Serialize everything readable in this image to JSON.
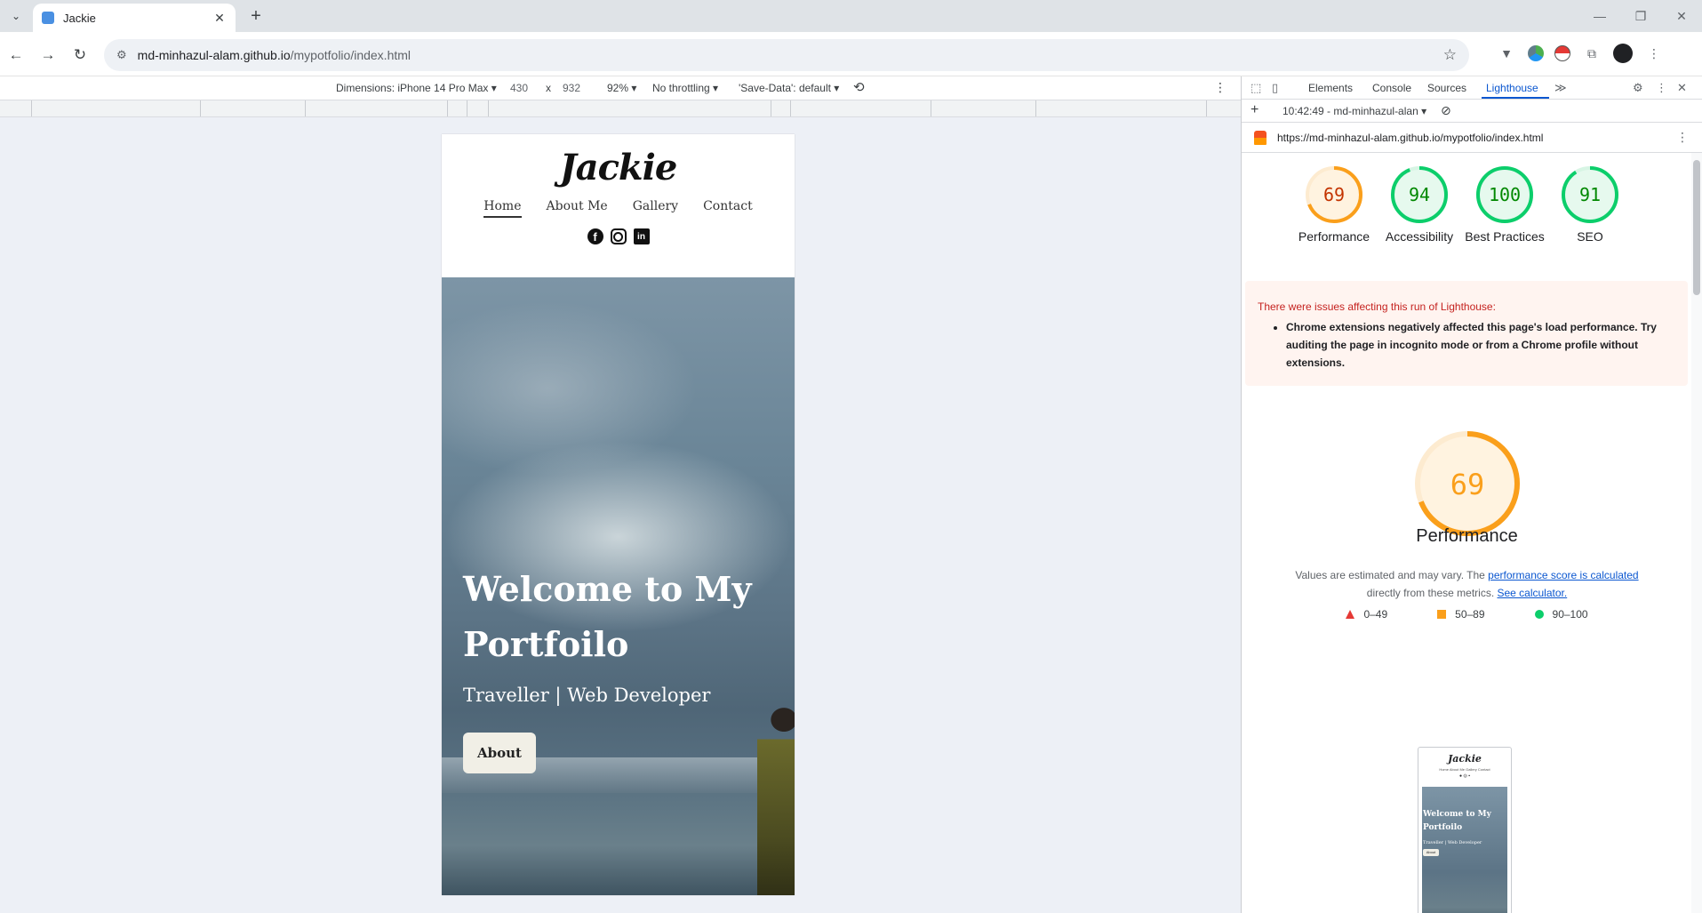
{
  "browser": {
    "tab_title": "Jackie",
    "tab_close": "✕",
    "new_tab": "+",
    "tab_search": "⌄",
    "window_minimize": "—",
    "window_restore": "❐",
    "window_close": "✕",
    "url_host": "md-minhazul-alam.github.io",
    "url_path": "/mypotfolio/index.html",
    "back": "←",
    "forward": "→",
    "reload": "↻",
    "bookmark": "☆"
  },
  "device_toolbar": {
    "dimensions_label": "Dimensions: iPhone 14 Pro Max ▾",
    "width": "430",
    "times": "x",
    "height": "932",
    "zoom": "92% ▾",
    "throttling": "No throttling ▾",
    "save_data": "'Save-Data': default ▾",
    "more": "⋮"
  },
  "site": {
    "brand": "Jackie",
    "nav": [
      "Home",
      "About Me",
      "Gallery",
      "Contact"
    ],
    "active_nav_index": 0,
    "hero_title": "Welcome to My Portfoilo",
    "hero_subtitle": "Traveller | Web Developer",
    "hero_button": "About",
    "social_icons": [
      "facebook-icon",
      "instagram-icon",
      "linkedin-icon"
    ]
  },
  "devtools": {
    "tabs": [
      "Elements",
      "Console",
      "Sources",
      "Lighthouse"
    ],
    "active_tab": "Lighthouse",
    "more_tabs": "≫",
    "report_time": "10:42:49 - md-minhazul-alan ▾",
    "add": "+",
    "clear": "⊘",
    "report_url": "https://md-minhazul-alam.github.io/mypotfolio/index.html",
    "report_menu": "⋮"
  },
  "lighthouse": {
    "scores": [
      {
        "label": "Performance",
        "value": 69,
        "color": "#fa9f1b",
        "text_color": "#c33300"
      },
      {
        "label": "Accessibility",
        "value": 94,
        "color": "#0cce6b",
        "text_color": "#008800"
      },
      {
        "label": "Best Practices",
        "value": 100,
        "color": "#0cce6b",
        "text_color": "#008800"
      },
      {
        "label": "SEO",
        "value": 91,
        "color": "#0cce6b",
        "text_color": "#008800"
      }
    ],
    "warning_title": "There were issues affecting this run of Lighthouse:",
    "warning_item": "Chrome extensions negatively affected this page's load performance. Try auditing the page in incognito mode or from a Chrome profile without extensions.",
    "performance_score": 69,
    "performance_title": "Performance",
    "note_prefix": "Values are estimated and may vary. The ",
    "note_link1": "performance score is calculated",
    "note_middle": " directly from these metrics. ",
    "note_link2": "See calculator.",
    "legend": [
      "0–49",
      "50–89",
      "90–100"
    ],
    "thumb": {
      "brand": "Jackie",
      "nav": "Home   About Me   Gallery   Contact",
      "socials": "● ◎ ▪",
      "title": "Welcome to My Portfoilo",
      "subtitle": "Traveller | Web Developer",
      "button": "About"
    }
  }
}
